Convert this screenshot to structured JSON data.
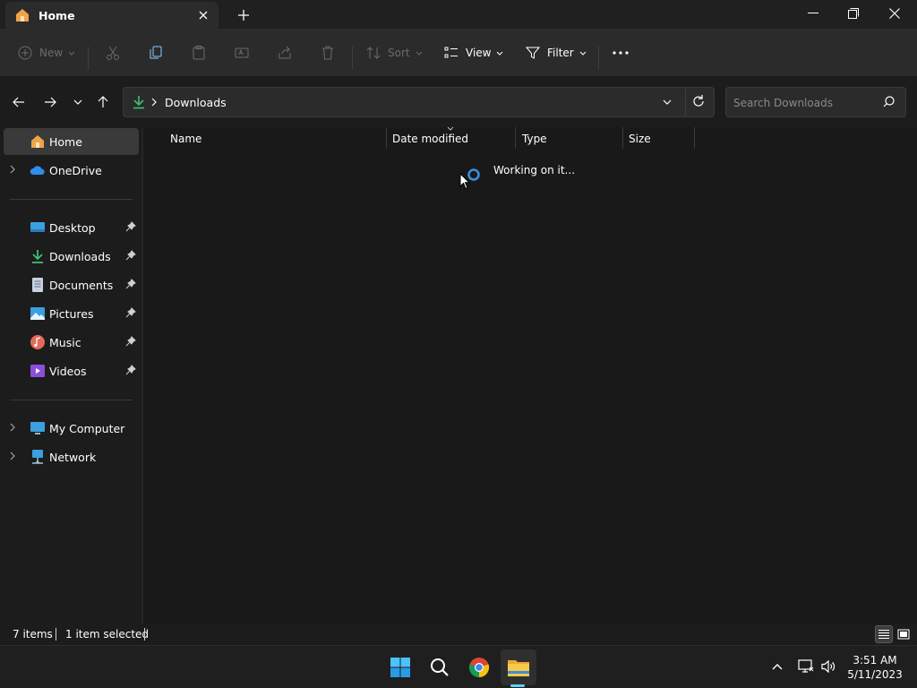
{
  "window": {
    "tab_title": "Home",
    "new_tab_symbol": "+",
    "controls": [
      "minimize-icon",
      "restore-icon",
      "close-icon"
    ]
  },
  "commandbar": {
    "new_label": "New",
    "sort_label": "Sort",
    "view_label": "View",
    "filter_label": "Filter",
    "icons": [
      "cut-icon",
      "copy-icon",
      "paste-icon",
      "rename-icon",
      "share-icon",
      "delete-icon",
      "more-icon"
    ]
  },
  "address": {
    "crumb": "Downloads",
    "search_placeholder": "Search Downloads"
  },
  "sidebar": {
    "items": [
      {
        "label": "Home",
        "icon": "home-icon",
        "selected": true
      },
      {
        "label": "OneDrive",
        "icon": "cloud-icon",
        "expandable": true
      },
      {
        "label": "Desktop",
        "icon": "desktop-icon",
        "pinned": true
      },
      {
        "label": "Downloads",
        "icon": "download-icon",
        "pinned": true
      },
      {
        "label": "Documents",
        "icon": "document-icon",
        "pinned": true
      },
      {
        "label": "Pictures",
        "icon": "pictures-icon",
        "pinned": true
      },
      {
        "label": "Music",
        "icon": "music-icon",
        "pinned": true
      },
      {
        "label": "Videos",
        "icon": "videos-icon",
        "pinned": true
      },
      {
        "label": "My Computer",
        "icon": "computer-icon",
        "expandable": true
      },
      {
        "label": "Network",
        "icon": "network-icon",
        "expandable": true
      }
    ]
  },
  "content": {
    "columns": [
      "Name",
      "Date modified",
      "Type",
      "Size"
    ],
    "status_message": "Working on it..."
  },
  "statusbar": {
    "item_count": "7 items",
    "selection": "1 item selected"
  },
  "taskbar": {
    "apps": [
      "start-icon",
      "search-icon",
      "chrome-icon",
      "file-explorer-icon"
    ],
    "time": "3:51 AM",
    "date": "5/11/2023"
  },
  "colors": {
    "accent": "#60cdff",
    "download_green": "#3fbf73",
    "folder_yellow": "#f5c342"
  }
}
